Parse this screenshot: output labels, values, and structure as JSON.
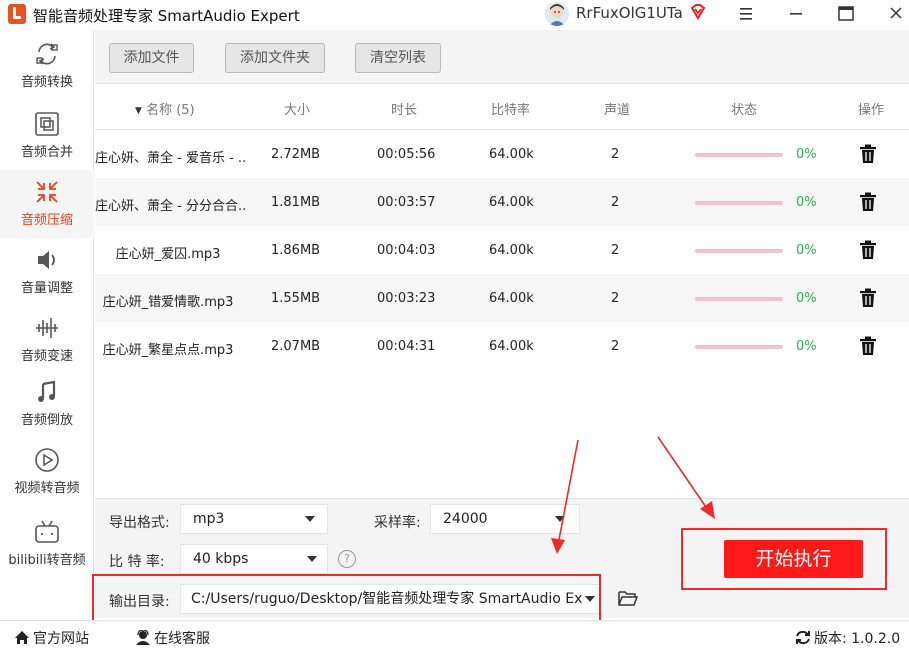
{
  "app": {
    "title": "智能音频处理专家 SmartAudio Expert",
    "user_name": "RrFuxOlG1UTa"
  },
  "sidebar": {
    "items": [
      {
        "label": "音频转换",
        "icon": "audio-convert-icon",
        "active": false
      },
      {
        "label": "音频合并",
        "icon": "audio-merge-icon",
        "active": false
      },
      {
        "label": "音频压缩",
        "icon": "audio-compress-icon",
        "active": true
      },
      {
        "label": "音量调整",
        "icon": "volume-icon",
        "active": false
      },
      {
        "label": "音频变速",
        "icon": "speed-icon",
        "active": false
      },
      {
        "label": "音频倒放",
        "icon": "music-note-icon",
        "active": false
      },
      {
        "label": "视频转音频",
        "icon": "play-circle-icon",
        "active": false
      },
      {
        "label": "bilibili转音频",
        "icon": "bilibili-tv-icon",
        "active": false
      }
    ]
  },
  "toolbar": {
    "add_file": "添加文件",
    "add_folder": "添加文件夹",
    "clear_list": "清空列表"
  },
  "table": {
    "columns": {
      "name": "名称 (5)",
      "size": "大小",
      "duration": "时长",
      "bitrate": "比特率",
      "channels": "声道",
      "status": "状态",
      "action": "操作"
    },
    "rows": [
      {
        "name": "庄心妍、萧全 - 爱音乐 - ...",
        "size": "2.72MB",
        "duration": "00:05:56",
        "bitrate": "64.00k",
        "channels": "2",
        "progress": 0,
        "progress_text": "0%"
      },
      {
        "name": "庄心妍、萧全 - 分分合合....",
        "size": "1.81MB",
        "duration": "00:03:57",
        "bitrate": "64.00k",
        "channels": "2",
        "progress": 0,
        "progress_text": "0%"
      },
      {
        "name": "庄心妍_爱囚.mp3",
        "size": "1.86MB",
        "duration": "00:04:03",
        "bitrate": "64.00k",
        "channels": "2",
        "progress": 0,
        "progress_text": "0%"
      },
      {
        "name": "庄心妍_错爱情歌.mp3",
        "size": "1.55MB",
        "duration": "00:03:23",
        "bitrate": "64.00k",
        "channels": "2",
        "progress": 0,
        "progress_text": "0%"
      },
      {
        "name": "庄心妍_繁星点点.mp3",
        "size": "2.07MB",
        "duration": "00:04:31",
        "bitrate": "64.00k",
        "channels": "2",
        "progress": 0,
        "progress_text": "0%"
      }
    ]
  },
  "settings": {
    "format_label": "导出格式:",
    "format_value": "mp3",
    "samplerate_label": "采样率:",
    "samplerate_value": "24000",
    "bitrate_label": "比 特 率:",
    "bitrate_value": "40 kbps",
    "help_glyph": "?",
    "output_label": "输出目录:",
    "output_value": "C:/Users/ruguo/Desktop/智能音频处理专家 SmartAudio Ex",
    "start_button": "开始执行"
  },
  "statusbar": {
    "website": "官方网站",
    "support": "在线客服",
    "version": "版本: 1.0.2.0"
  },
  "colors": {
    "accent": "#e8411c",
    "start_button": "#ff1a1a",
    "annotation": "#f02a2a",
    "progress_text": "#2bb24c",
    "progress_track": "#f3c2cd"
  }
}
